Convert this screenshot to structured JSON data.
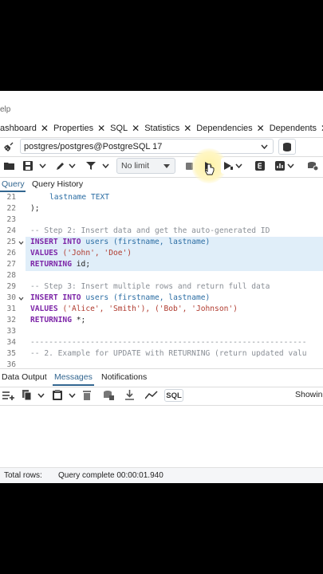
{
  "menu": {
    "help_fragment": "elp"
  },
  "tabs": [
    {
      "label": "ashboard",
      "close": "✕"
    },
    {
      "label": "Properties",
      "close": "✕"
    },
    {
      "label": "SQL",
      "close": "✕"
    },
    {
      "label": "Statistics",
      "close": "✕"
    },
    {
      "label": "Dependencies",
      "close": "✕"
    },
    {
      "label": "Dependents",
      "close": "✕"
    }
  ],
  "connection": {
    "value": "postgres/postgres@PostgreSQL 17"
  },
  "toolbar": {
    "limit_label": "No limit"
  },
  "query_tabs": {
    "query": "Query",
    "history": "Query History"
  },
  "editor": {
    "line_numbers": [
      "21",
      "22",
      "23",
      "24",
      "25",
      "26",
      "27",
      "28",
      "29",
      "30",
      "31",
      "32",
      "33",
      "34",
      "35",
      "36"
    ],
    "lines": {
      "l21": "lastname TEXT",
      "l22": ");",
      "l24": "-- Step 2: Insert data and get the auto-generated ID",
      "l25_kw": "INSERT INTO",
      "l25_id": "users",
      "l25_rest": "(firstname, lastname)",
      "l26_kw": "VALUES",
      "l26_rest": "('John', 'Doe')",
      "l27_kw": "RETURNING",
      "l27_rest": "id;",
      "l29": "-- Step 3: Insert multiple rows and return full data",
      "l30_kw": "INSERT INTO",
      "l30_id": "users",
      "l30_rest": "(firstname, lastname)",
      "l31_kw": "VALUES",
      "l31_rest": "('Alice', 'Smith'), ('Bob', 'Johnson')",
      "l32_kw": "RETURNING",
      "l32_rest": "*;",
      "l34": "------------------------------------------------------------",
      "l35": "-- 2. Example for UPDATE with RETURNING (return updated valu"
    }
  },
  "output_tabs": {
    "data_output": "Data Output",
    "messages": "Messages",
    "notifications": "Notifications"
  },
  "output_toolbar": {
    "sql_label": "SQL",
    "showing": "Showin"
  },
  "status": {
    "total_rows": "Total rows:",
    "query_complete": "Query complete 00:00:01.940"
  },
  "colors": {
    "accent": "#326690",
    "keyword": "#7d26a8",
    "identifier": "#2c6ea4",
    "string": "#b03b2f",
    "comment": "#8a8f96",
    "highlight": "#e0eef9"
  }
}
